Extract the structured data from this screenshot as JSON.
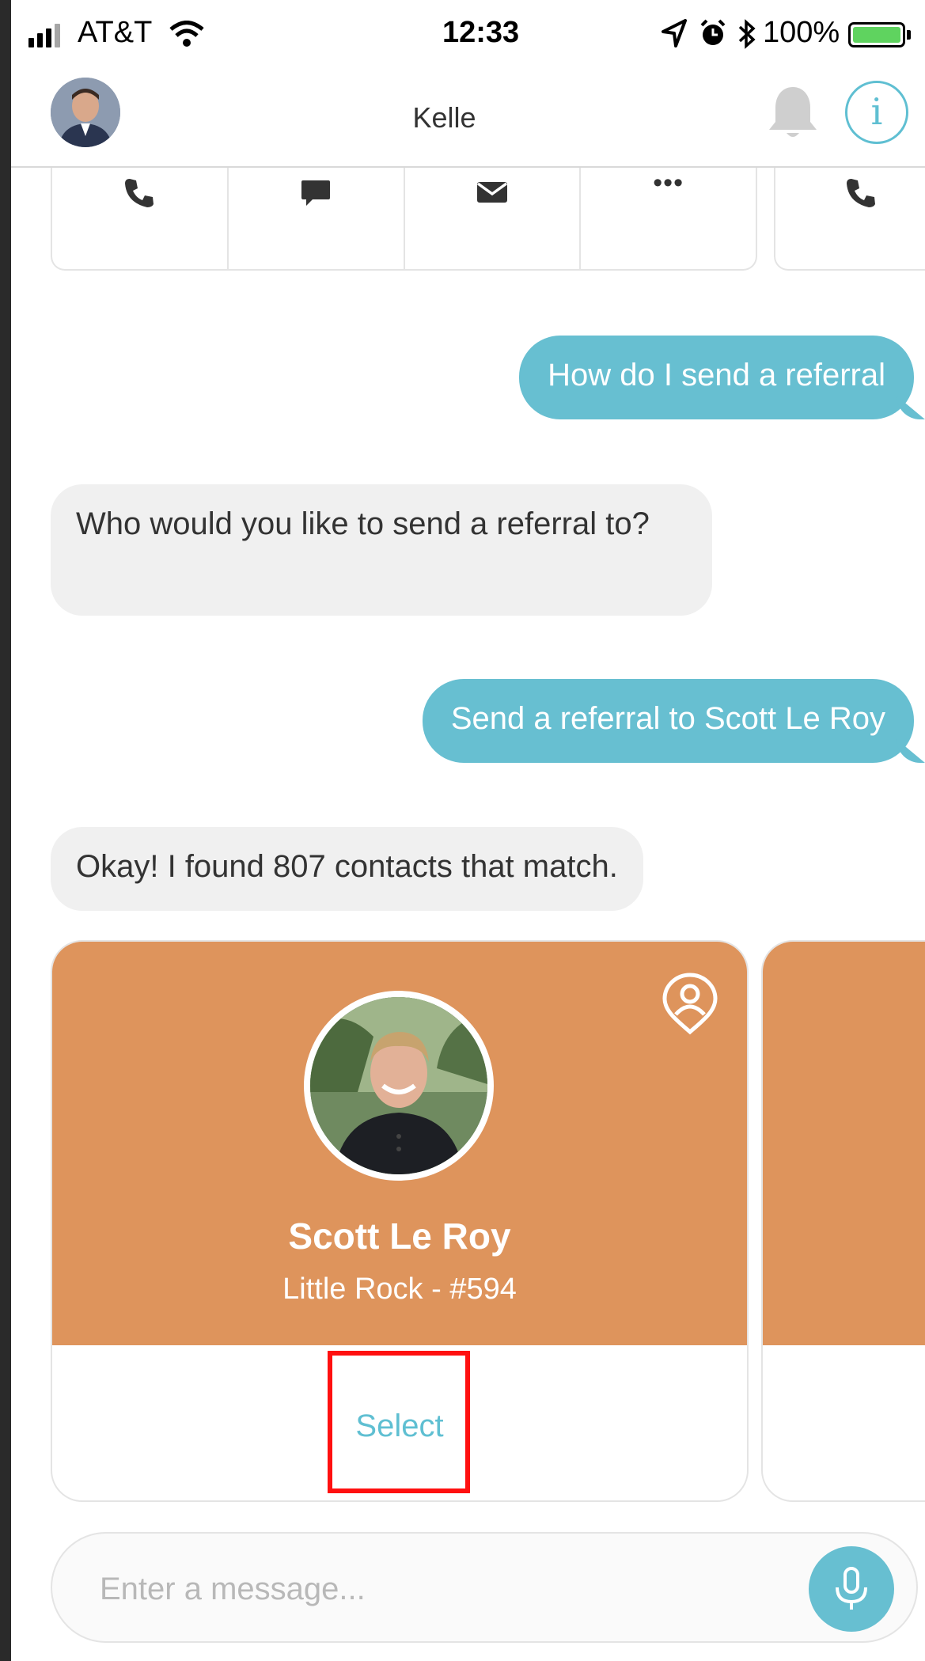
{
  "status_bar": {
    "carrier": "AT&T",
    "time": "12:33",
    "battery": "100%"
  },
  "nav": {
    "title": "Kelle"
  },
  "action_strip": {
    "icons": [
      "phone-icon",
      "message-icon",
      "mail-icon",
      "more-icon",
      "phone-icon"
    ],
    "more_label": "•••"
  },
  "messages": [
    {
      "from": "user",
      "text": "How do I send a referral"
    },
    {
      "from": "bot",
      "text": "Who would you like to send a referral to?"
    },
    {
      "from": "user",
      "text": "Send a referral to Scott Le Roy"
    },
    {
      "from": "bot",
      "text": "Okay! I found 807 contacts that match."
    }
  ],
  "contact_cards": [
    {
      "name": "Scott Le Roy",
      "subtitle": "Little Rock - #594",
      "action": "Select"
    }
  ],
  "input": {
    "placeholder": "Enter a message..."
  },
  "colors": {
    "accent": "#67bfd1",
    "card": "#de945c",
    "bot_bubble": "#f0f0f0",
    "highlight": "#ff1010"
  }
}
